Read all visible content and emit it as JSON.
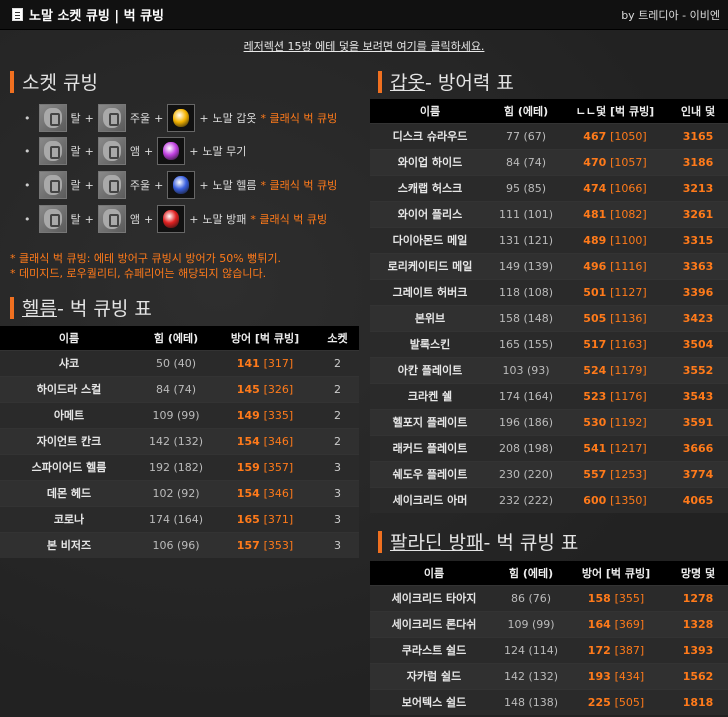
{
  "header": {
    "title": "노말 소켓 큐빙 | 벅 큐빙",
    "byline": "by 트레디아 - 이비엔"
  },
  "notice": "레저렉션 15방 에테 덫을 보려면 여기를 클릭하세요.",
  "socket_section": {
    "title": "소켓 큐빙",
    "rows": [
      {
        "rune1": "탈",
        "rune2": "주울",
        "gem_color": "#f5b400",
        "result": "노말 갑옷",
        "note": "* 클래식 벅 큐빙"
      },
      {
        "rune1": "랄",
        "rune2": "앰",
        "gem_color": "#c040e0",
        "result": "노말 무기",
        "note": ""
      },
      {
        "rune1": "랄",
        "rune2": "주울",
        "gem_color": "#3a60e0",
        "result": "노말 헬름",
        "note": "* 클래식 벅 큐빙"
      },
      {
        "rune1": "탈",
        "rune2": "앰",
        "gem_color": "#e02020",
        "result": "노말 방패",
        "note": "* 클래식 벅 큐빙"
      }
    ],
    "notes": [
      "* 클래식 벅 큐빙: 에테 방어구 큐빙시 방어가 50% 뻥튀기.",
      "* 데미지드, 로우퀄리티, 슈페리어는 해당되지 않습니다."
    ]
  },
  "helm_section": {
    "title_main": "헬름",
    "title_rest": " - 벅 큐빙 표",
    "columns": [
      "이름",
      "힘 (에테)",
      "방어 [벅 큐빙]",
      "소켓"
    ],
    "rows": [
      {
        "name": "샤코",
        "str": "50 (40)",
        "def": "141",
        "buck": "[317]",
        "socket": "2"
      },
      {
        "name": "하이드라 스컬",
        "str": "84 (74)",
        "def": "145",
        "buck": "[326]",
        "socket": "2"
      },
      {
        "name": "아메트",
        "str": "109 (99)",
        "def": "149",
        "buck": "[335]",
        "socket": "2"
      },
      {
        "name": "자이언트 칸크",
        "str": "142 (132)",
        "def": "154",
        "buck": "[346]",
        "socket": "2"
      },
      {
        "name": "스파이어드 헬름",
        "str": "192 (182)",
        "def": "159",
        "buck": "[357]",
        "socket": "3"
      },
      {
        "name": "데몬 헤드",
        "str": "102 (92)",
        "def": "154",
        "buck": "[346]",
        "socket": "3"
      },
      {
        "name": "코로나",
        "str": "174 (164)",
        "def": "165",
        "buck": "[371]",
        "socket": "3"
      },
      {
        "name": "본 비저즈",
        "str": "106 (96)",
        "def": "157",
        "buck": "[353]",
        "socket": "3"
      }
    ]
  },
  "armor_section": {
    "title_main": "갑옷",
    "title_rest": " - 방어력 표",
    "columns": [
      "이름",
      "힘 (에테)",
      "ㄴㄴ덫 [벅 큐빙]",
      "인내 덫"
    ],
    "rows": [
      {
        "name": "디스크 슈라우드",
        "str": "77 (67)",
        "def": "467",
        "buck": "[1050]",
        "ext": "3165"
      },
      {
        "name": "와이업 하이드",
        "str": "84 (74)",
        "def": "470",
        "buck": "[1057]",
        "ext": "3186"
      },
      {
        "name": "스캐랩 허스크",
        "str": "95 (85)",
        "def": "474",
        "buck": "[1066]",
        "ext": "3213"
      },
      {
        "name": "와이어 플리스",
        "str": "111 (101)",
        "def": "481",
        "buck": "[1082]",
        "ext": "3261"
      },
      {
        "name": "다이아몬드 메일",
        "str": "131 (121)",
        "def": "489",
        "buck": "[1100]",
        "ext": "3315"
      },
      {
        "name": "로리케이티드 메일",
        "str": "149 (139)",
        "def": "496",
        "buck": "[1116]",
        "ext": "3363"
      },
      {
        "name": "그레이트 허버크",
        "str": "118 (108)",
        "def": "501",
        "buck": "[1127]",
        "ext": "3396"
      },
      {
        "name": "본위브",
        "str": "158 (148)",
        "def": "505",
        "buck": "[1136]",
        "ext": "3423"
      },
      {
        "name": "발록스킨",
        "str": "165 (155)",
        "def": "517",
        "buck": "[1163]",
        "ext": "3504"
      },
      {
        "name": "아칸 플레이트",
        "str": "103 (93)",
        "def": "524",
        "buck": "[1179]",
        "ext": "3552"
      },
      {
        "name": "크라켄 쉘",
        "str": "174 (164)",
        "def": "523",
        "buck": "[1176]",
        "ext": "3543"
      },
      {
        "name": "헬포지 플레이트",
        "str": "196 (186)",
        "def": "530",
        "buck": "[1192]",
        "ext": "3591"
      },
      {
        "name": "래커드 플레이트",
        "str": "208 (198)",
        "def": "541",
        "buck": "[1217]",
        "ext": "3666"
      },
      {
        "name": "쉐도우 플레이트",
        "str": "230 (220)",
        "def": "557",
        "buck": "[1253]",
        "ext": "3774"
      },
      {
        "name": "세이크리드 아머",
        "str": "232 (222)",
        "def": "600",
        "buck": "[1350]",
        "ext": "4065"
      }
    ]
  },
  "shield_section": {
    "title_main": "팔라딘 방패",
    "title_rest": " - 벅 큐빙 표",
    "columns": [
      "이름",
      "힘 (에테)",
      "방어 [벅 큐빙]",
      "망명 덫"
    ],
    "rows": [
      {
        "name": "세이크리드 타아지",
        "str": "86 (76)",
        "def": "158",
        "buck": "[355]",
        "ext": "1278"
      },
      {
        "name": "세이크리드 론다쉬",
        "str": "109 (99)",
        "def": "164",
        "buck": "[369]",
        "ext": "1328"
      },
      {
        "name": "쿠라스트 쉴드",
        "str": "124 (114)",
        "def": "172",
        "buck": "[387]",
        "ext": "1393"
      },
      {
        "name": "자카럼 쉴드",
        "str": "142 (132)",
        "def": "193",
        "buck": "[434]",
        "ext": "1562"
      },
      {
        "name": "보어텍스 쉴드",
        "str": "148 (138)",
        "def": "225",
        "buck": "[505]",
        "ext": "1818"
      }
    ]
  }
}
